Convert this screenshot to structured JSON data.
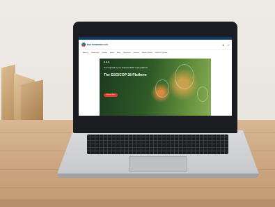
{
  "site": {
    "topbar_left": "",
    "topbar_right": "",
    "logo_text": "ESG POWERED GAS",
    "nav": [
      "About Us",
      "Membership",
      "Services",
      "Events",
      "News",
      "Newsletters",
      "Initiatives",
      "Member Platform",
      "ESG/COP Platform"
    ],
    "hero": {
      "overline": "Get inspired by our featured ESG topic platform",
      "title": "The ESG/COP 28 Platform",
      "body": "",
      "button": "Discover More"
    },
    "icons": [
      "user-icon",
      "search-icon"
    ]
  },
  "colors": {
    "brand_navy": "#0f3b68",
    "hero_button": "#e23b30",
    "desk": "#c9a37d"
  }
}
